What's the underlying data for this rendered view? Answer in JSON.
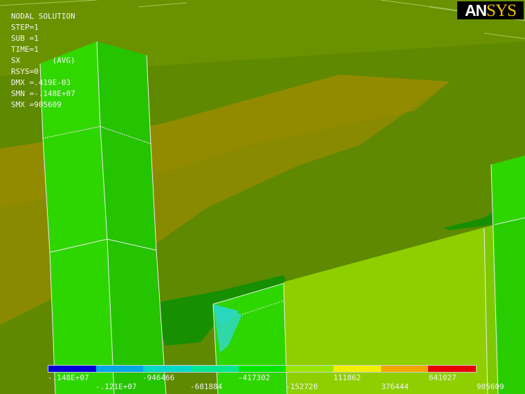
{
  "window": {
    "logo_primary": "AN",
    "logo_secondary": "SYS"
  },
  "info": {
    "title": "NODAL SOLUTION",
    "step": "STEP=1",
    "sub": "SUB =1",
    "time": "TIME=1",
    "result": "SX       (AVG)",
    "rsys": "RSYS=0",
    "dmx": "DMX =.419E-03",
    "smn": "SMN =-.148E+07",
    "smx": "SMX =905609"
  },
  "legend": {
    "colors": [
      "#0000d8",
      "#00a8e6",
      "#00d8c8",
      "#00e890",
      "#00e800",
      "#98e600",
      "#f0f000",
      "#f0a800",
      "#e80000"
    ],
    "labels_top": [
      "-.148E+07",
      "-946466",
      "-417302",
      "111862",
      "641027"
    ],
    "labels_bottom": [
      "-.121E+07",
      "-681884",
      "-152720",
      "376444",
      "905609"
    ]
  },
  "colors": {
    "background": "#608b00",
    "wedge": "#8f8a00",
    "column": "#2cd400",
    "column_side": "#24c000",
    "plate": "#90d000",
    "shadow": "#158f00",
    "edge": "#e6e6e6",
    "cyan_patch": "#30d8a8"
  }
}
